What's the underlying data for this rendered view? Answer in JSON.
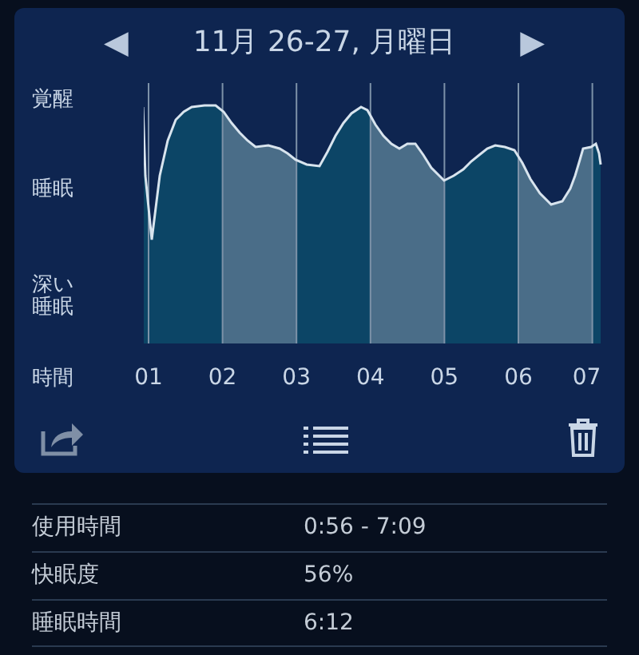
{
  "header": {
    "prev": "◀",
    "title": "11月 26-27, 月曜日",
    "next": "▶"
  },
  "graph": {
    "y_labels": [
      "覚醒",
      "睡眠",
      "深い睡眠"
    ],
    "axis_label": "時間",
    "x_labels": [
      "01",
      "02",
      "03",
      "04",
      "05",
      "06",
      "07"
    ]
  },
  "stats": [
    {
      "label": "使用時間",
      "value": "0:56 - 7:09"
    },
    {
      "label": "快眠度",
      "value": "56%"
    },
    {
      "label": "睡眠時間",
      "value": "6:12"
    }
  ]
}
